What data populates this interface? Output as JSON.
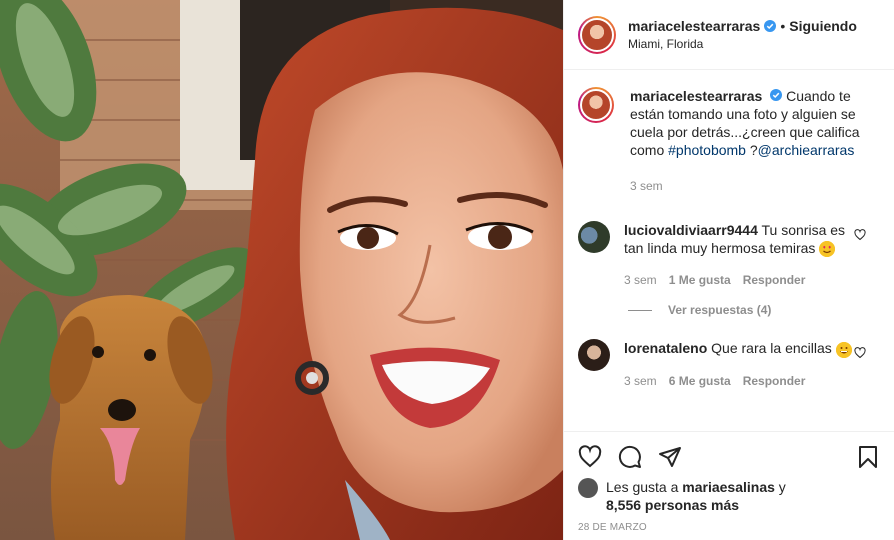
{
  "post": {
    "username": "mariacelestearraras",
    "dot": "•",
    "follow_label": "Siguiendo",
    "location": "Miami, Florida"
  },
  "caption": {
    "username": "mariacelestearraras",
    "text": "Cuando te están tomando una foto y alguien se cuela por detrás...¿creen que califica como ",
    "hashtag": "#photobomb",
    "mid": " ?",
    "mention": "@archiearraras",
    "time": "3 sem"
  },
  "comments": [
    {
      "username": "luciovaldiviaarr9444",
      "text": "Tu sonrisa es tan linda muy hermosa temiras",
      "time": "3 sem",
      "likes": "1 Me gusta",
      "reply": "Responder"
    },
    {
      "username": "lorenataleno",
      "text": "Que rara la encillas",
      "time": "3 sem",
      "likes": "6 Me gusta",
      "reply": "Responder"
    }
  ],
  "view_replies": "Ver respuestas (4)",
  "likes_line": {
    "prefix": "Les gusta a ",
    "user": "mariaesalinas",
    "suffix": " y",
    "others": "8,556 personas más"
  },
  "date": "28 DE MARZO",
  "colors": {
    "verified": "#3897f0",
    "link": "#00376b",
    "meta": "#8e8e8e"
  },
  "icons": [
    "verified-icon",
    "heart-icon",
    "comment-icon",
    "share-icon",
    "bookmark-icon"
  ]
}
